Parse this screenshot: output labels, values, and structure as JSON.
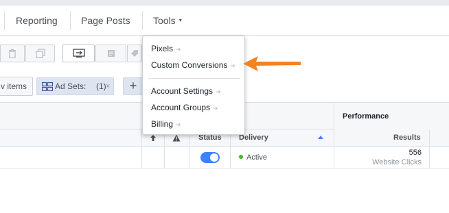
{
  "nav": {
    "items": [
      {
        "label": "Reporting"
      },
      {
        "label": "Page Posts"
      },
      {
        "label": "Tools",
        "caret": "▾"
      }
    ]
  },
  "toolbar": {
    "icons": [
      "delete-icon",
      "duplicate-icon",
      "edit-icon",
      "notes-icon",
      "tag-icon"
    ]
  },
  "filters": {
    "view_items_label": "v items",
    "adset_chip": {
      "label": "Ad Sets:",
      "count": "(1)",
      "remove": "×"
    },
    "add_label": "+"
  },
  "table": {
    "group_header": "Performance",
    "columns": {
      "status": "Status",
      "delivery": "Delivery",
      "results": "Results"
    },
    "rows": [
      {
        "status_on": true,
        "delivery": "Active",
        "results": "556",
        "results_type": "Website Clicks"
      }
    ]
  },
  "tools_menu": {
    "items": [
      {
        "label": "Pixels",
        "arrow": "➔"
      },
      {
        "label": "Custom Conversions",
        "arrow": "➔"
      },
      {
        "label": "Account Settings",
        "arrow": "➔"
      },
      {
        "label": "Account Groups",
        "arrow": "➔"
      },
      {
        "label": "Billing",
        "arrow": "➔"
      }
    ]
  },
  "colors": {
    "accent": "#4080ff",
    "active_status": "#42b72a",
    "callout_arrow": "#f58220"
  }
}
